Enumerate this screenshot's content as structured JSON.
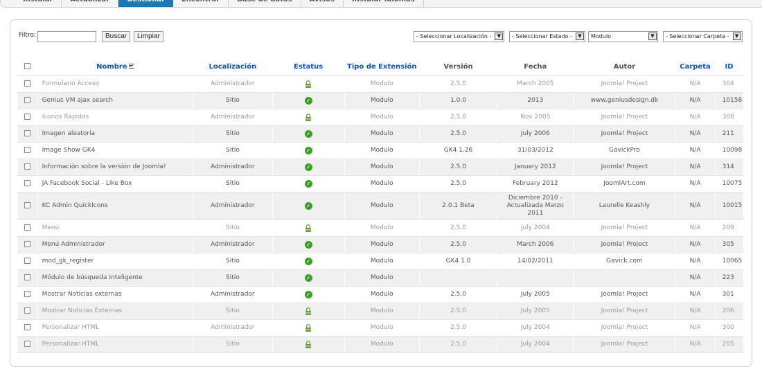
{
  "tabs": [
    "Instalar",
    "Actualizar",
    "Gestionar",
    "Encontrar",
    "Base de datos",
    "Avisos",
    "Instalar idiomas"
  ],
  "active_tab": 2,
  "filter": {
    "label": "Filtro:",
    "value": "",
    "search_label": "Buscar",
    "clear_label": "Limpiar",
    "location_select": "- Seleccionar Localización -",
    "state_select": "- Seleccionar Estado -",
    "type_select": "Modulo",
    "folder_select": "- Seleccionar Carpeta -"
  },
  "columns": {
    "name": "Nombre",
    "location": "Localización",
    "status": "Estatus",
    "type": "Tipo de Extensión",
    "version": "Versión",
    "date": "Fecha",
    "author": "Autor",
    "folder": "Carpeta",
    "id": "ID"
  },
  "rows": [
    {
      "name": "Formulario Acceso",
      "location": "Administrador",
      "status": "locked",
      "type": "Modulo",
      "version": "2.5.0",
      "date": "March 2005",
      "author": "Joomla! Project",
      "folder": "N/A",
      "id": "304"
    },
    {
      "name": "Genius VM ajax search",
      "location": "Sitio",
      "status": "enabled",
      "type": "Modulo",
      "version": "1.0.0",
      "date": "2013",
      "author": "www.geniusdesign.dk",
      "folder": "N/A",
      "id": "10158"
    },
    {
      "name": "Iconos Rápidos",
      "location": "Administrador",
      "status": "locked",
      "type": "Modulo",
      "version": "2.5.0",
      "date": "Nov 2005",
      "author": "Joomla! Project",
      "folder": "N/A",
      "id": "308"
    },
    {
      "name": "Imagen aleatoria",
      "location": "Sitio",
      "status": "enabled",
      "type": "Modulo",
      "version": "2.5.0",
      "date": "July 2006",
      "author": "Joomla! Project",
      "folder": "N/A",
      "id": "211"
    },
    {
      "name": "Image Show GK4",
      "location": "Sitio",
      "status": "enabled",
      "type": "Modulo",
      "version": "GK4 1.26",
      "date": "31/03/2012",
      "author": "GavickPro",
      "folder": "N/A",
      "id": "10098"
    },
    {
      "name": "Información sobre la versión de Joomla!",
      "location": "Administrador",
      "status": "enabled",
      "type": "Modulo",
      "version": "2.5.0",
      "date": "January 2012",
      "author": "Joomla! Project",
      "folder": "N/A",
      "id": "314"
    },
    {
      "name": "JA Facebook Social - Like Box",
      "location": "Sitio",
      "status": "enabled",
      "type": "Modulo",
      "version": "2.5.0",
      "date": "February 2012",
      "author": "JoomlArt.com",
      "folder": "N/A",
      "id": "10075"
    },
    {
      "name": "KC Admin QuickIcons",
      "location": "Administrador",
      "status": "enabled",
      "type": "Modulo",
      "version": "2.0.1 Beta",
      "date": "Diciembre 2010 - Actualizada Marzo 2011",
      "author": "Laurelle Keashly",
      "folder": "N/A",
      "id": "10015"
    },
    {
      "name": "Menú",
      "location": "Sitio",
      "status": "locked",
      "type": "Modulo",
      "version": "2.5.0",
      "date": "July 2004",
      "author": "Joomla! Project",
      "folder": "N/A",
      "id": "209"
    },
    {
      "name": "Menú Administrador",
      "location": "Administrador",
      "status": "enabled",
      "type": "Modulo",
      "version": "2.5.0",
      "date": "March 2006",
      "author": "Joomla! Project",
      "folder": "N/A",
      "id": "305"
    },
    {
      "name": "mod_gk_register",
      "location": "Sitio",
      "status": "enabled",
      "type": "Modulo",
      "version": "GK4 1.0",
      "date": "14/02/2011",
      "author": "Gavick.com",
      "folder": "N/A",
      "id": "10065"
    },
    {
      "name": "Módulo de búsqueda Inteligente",
      "location": "Sitio",
      "status": "enabled",
      "type": "Modulo",
      "version": "",
      "date": "",
      "author": "",
      "folder": "N/A",
      "id": "223"
    },
    {
      "name": "Mostrar Noticias externas",
      "location": "Administrador",
      "status": "enabled",
      "type": "Modulo",
      "version": "2.5.0",
      "date": "July 2005",
      "author": "Joomla! Project",
      "folder": "N/A",
      "id": "301"
    },
    {
      "name": "Mostrar Noticias Externas",
      "location": "Sitio",
      "status": "locked",
      "type": "Modulo",
      "version": "2.5.0",
      "date": "July 2005",
      "author": "Joomla! Project",
      "folder": "N/A",
      "id": "206"
    },
    {
      "name": "Personalizar HTML",
      "location": "Administrador",
      "status": "locked",
      "type": "Modulo",
      "version": "2.5.0",
      "date": "July 2004",
      "author": "Joomla! Project",
      "folder": "N/A",
      "id": "300"
    },
    {
      "name": "Personalizar HTML",
      "location": "Sitio",
      "status": "locked",
      "type": "Modulo",
      "version": "2.5.0",
      "date": "July 2004",
      "author": "Joomla! Project",
      "folder": "N/A",
      "id": "205"
    }
  ],
  "colors": {
    "link": "#0b55c4",
    "active_tab": "#1b79b4",
    "enabled": "#3e9d2a",
    "locked": "#6a9e3a"
  }
}
